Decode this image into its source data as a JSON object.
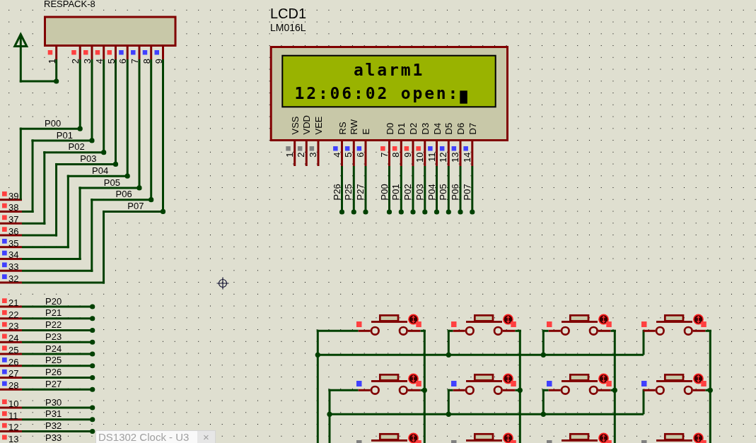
{
  "resistor_pack": {
    "label": "RESPACK-8",
    "pins": [
      {
        "number": "1",
        "color": "#ff4040"
      },
      {
        "number": "2",
        "color": "#ff4040"
      },
      {
        "number": "3",
        "color": "#ff4040"
      },
      {
        "number": "4",
        "color": "#ff4040"
      },
      {
        "number": "5",
        "color": "#ff4040"
      },
      {
        "number": "6",
        "color": "#4040ff"
      },
      {
        "number": "7",
        "color": "#4040ff"
      },
      {
        "number": "8",
        "color": "#4040ff"
      },
      {
        "number": "9",
        "color": "#4040ff"
      }
    ]
  },
  "port0_pins": [
    {
      "number": "39",
      "net": "P00",
      "color": "#ff4040"
    },
    {
      "number": "38",
      "net": "P01",
      "color": "#ff4040"
    },
    {
      "number": "37",
      "net": "P02",
      "color": "#ff4040"
    },
    {
      "number": "36",
      "net": "P03",
      "color": "#ff4040"
    },
    {
      "number": "35",
      "net": "P04",
      "color": "#4040ff"
    },
    {
      "number": "34",
      "net": "P05",
      "color": "#4040ff"
    },
    {
      "number": "33",
      "net": "P06",
      "color": "#4040ff"
    },
    {
      "number": "32",
      "net": "P07",
      "color": "#4040ff"
    }
  ],
  "port2_pins": [
    {
      "number": "21",
      "net": "P20",
      "color": "#ff4040"
    },
    {
      "number": "22",
      "net": "P21",
      "color": "#ff4040"
    },
    {
      "number": "23",
      "net": "P22",
      "color": "#ff4040"
    },
    {
      "number": "24",
      "net": "P23",
      "color": "#ff4040"
    },
    {
      "number": "25",
      "net": "P24",
      "color": "#ff4040"
    },
    {
      "number": "26",
      "net": "P25",
      "color": "#4040ff"
    },
    {
      "number": "27",
      "net": "P26",
      "color": "#4040ff"
    },
    {
      "number": "28",
      "net": "P27",
      "color": "#4040ff"
    }
  ],
  "port3_pins": [
    {
      "number": "10",
      "net": "P30",
      "color": "#ff4040"
    },
    {
      "number": "11",
      "net": "P31",
      "color": "#ff4040"
    },
    {
      "number": "12",
      "net": "P32",
      "color": "#ff4040"
    },
    {
      "number": "13",
      "net": "P33",
      "color": "#ff4040"
    }
  ],
  "lcd": {
    "reference": "LCD1",
    "part": "LM016L",
    "lines": [
      "alarm1",
      "12:06:02 open:"
    ],
    "cursor": true,
    "pins": [
      {
        "number": "1",
        "name": "VSS",
        "color": "#808080"
      },
      {
        "number": "2",
        "name": "VDD",
        "color": "#808080"
      },
      {
        "number": "3",
        "name": "VEE",
        "color": "#808080"
      },
      {
        "number": "4",
        "name": "RS",
        "color": "#4040ff",
        "net": "P26"
      },
      {
        "number": "5",
        "name": "RW",
        "color": "#4040ff",
        "net": "P25"
      },
      {
        "number": "6",
        "name": "E",
        "color": "#4040ff",
        "net": "P27"
      },
      {
        "number": "7",
        "name": "D0",
        "color": "#ff4040",
        "net": "P00"
      },
      {
        "number": "8",
        "name": "D1",
        "color": "#ff4040",
        "net": "P01"
      },
      {
        "number": "9",
        "name": "D2",
        "color": "#ff4040",
        "net": "P02"
      },
      {
        "number": "10",
        "name": "D3",
        "color": "#ff4040",
        "net": "P03"
      },
      {
        "number": "11",
        "name": "D4",
        "color": "#4040ff",
        "net": "P04"
      },
      {
        "number": "12",
        "name": "D5",
        "color": "#4040ff",
        "net": "P05"
      },
      {
        "number": "13",
        "name": "D6",
        "color": "#4040ff",
        "net": "P06"
      },
      {
        "number": "14",
        "name": "D7",
        "color": "#4040ff",
        "net": "P07"
      }
    ]
  },
  "keypad": {
    "rows": [
      [
        {
          "pins": [
            {
              "color": "#ff4040"
            },
            {
              "color": "#ff4040"
            }
          ]
        },
        {
          "pins": [
            {
              "color": "#ff4040"
            },
            {
              "color": "#ff4040"
            }
          ]
        },
        {
          "pins": [
            {
              "color": "#ff4040"
            },
            {
              "color": "#ff4040"
            }
          ]
        },
        {
          "pins": [
            {
              "color": "#ff4040"
            },
            {
              "color": "#ff4040"
            }
          ]
        }
      ],
      [
        {
          "pins": [
            {
              "color": "#4040ff"
            },
            {
              "color": "#ff4040"
            }
          ]
        },
        {
          "pins": [
            {
              "color": "#4040ff"
            },
            {
              "color": "#ff4040"
            }
          ]
        },
        {
          "pins": [
            {
              "color": "#4040ff"
            },
            {
              "color": "#ff4040"
            }
          ]
        },
        {
          "pins": [
            {
              "color": "#4040ff"
            },
            {
              "color": "#ff4040"
            }
          ]
        }
      ],
      [
        {
          "pins": [
            {
              "color": "#808080"
            },
            {
              "color": "#ff4040"
            }
          ]
        },
        {
          "pins": [
            {
              "color": "#808080"
            },
            {
              "color": "#ff4040"
            }
          ]
        },
        {
          "pins": [
            {
              "color": "#808080"
            },
            {
              "color": "#ff4040"
            }
          ]
        },
        {
          "pins": [
            {
              "color": "#808080"
            },
            {
              "color": "#ff4040"
            }
          ]
        }
      ]
    ]
  },
  "popup": {
    "title": "DS1302 Clock - U3",
    "close_label": "×"
  }
}
